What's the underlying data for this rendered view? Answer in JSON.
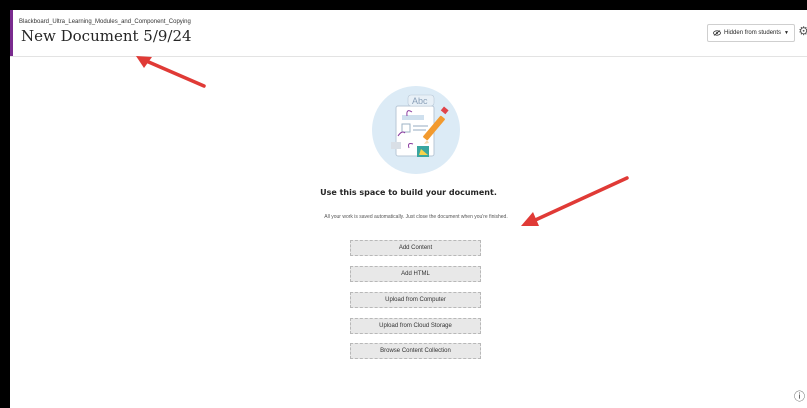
{
  "header": {
    "breadcrumb": "Blackboard_Ultra_Learning_Modules_and_Component_Copying",
    "title": "New Document 5/9/24",
    "visibility_label": "Hidden from students",
    "visibility_icon": "eye-slash-icon",
    "settings_icon": "gear-icon"
  },
  "hero": {
    "illustration_text": "Abc"
  },
  "main": {
    "heading": "Use this space to build your document.",
    "subtext": "All your work is saved automatically. Just close the document when you're finished.",
    "actions": [
      {
        "label": "Add Content"
      },
      {
        "label": "Add HTML"
      },
      {
        "label": "Upload from Computer"
      },
      {
        "label": "Upload from Cloud Storage"
      },
      {
        "label": "Browse Content Collection"
      }
    ]
  },
  "colors": {
    "accent": "#7a2b8f",
    "annotation_arrow": "#e03a36",
    "hero_circle": "#dcebf6"
  }
}
